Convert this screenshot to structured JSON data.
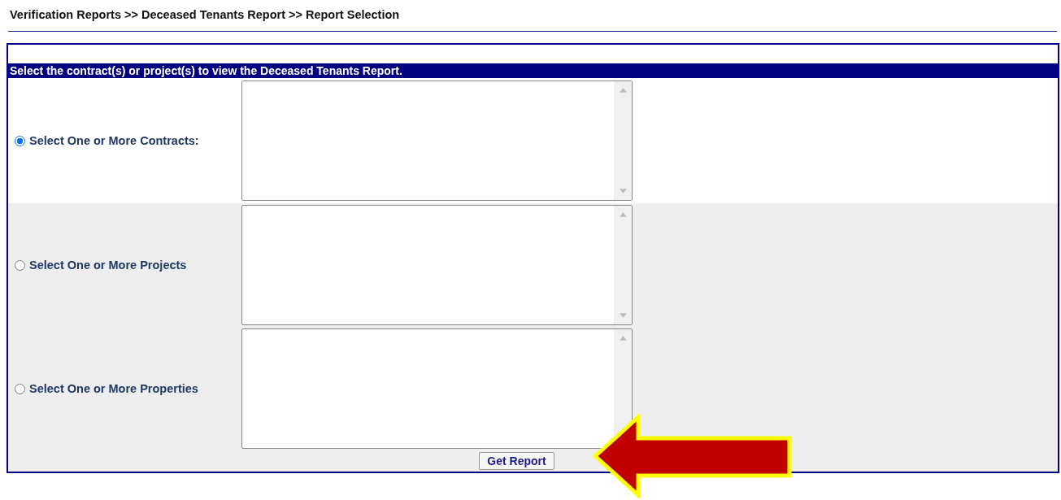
{
  "breadcrumb": "Verification Reports >> Deceased Tenants Report >> Report Selection",
  "panel": {
    "header": "Select the contract(s) or project(s) to view the Deceased Tenants Report.",
    "options": [
      {
        "label": "Select One or More Contracts:",
        "selected": true
      },
      {
        "label": "Select One or More Projects",
        "selected": false
      },
      {
        "label": "Select One or More Properties",
        "selected": false
      }
    ],
    "button": "Get Report"
  },
  "callout": {
    "kind": "arrow"
  }
}
